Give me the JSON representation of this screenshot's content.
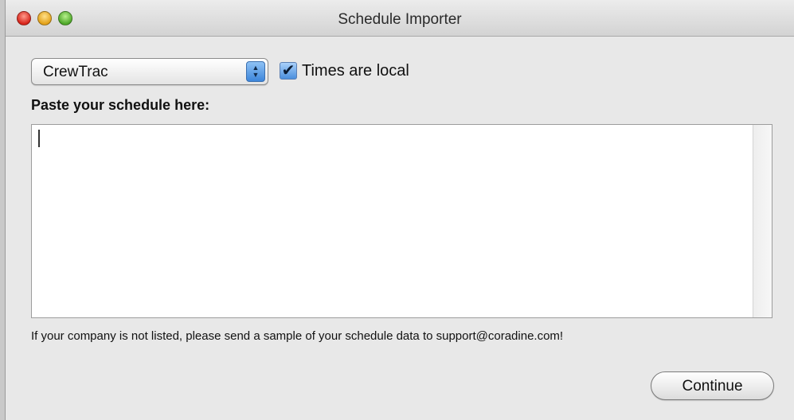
{
  "window": {
    "title": "Schedule Importer"
  },
  "import_source": {
    "selected": "CrewTrac"
  },
  "times_local": {
    "label": "Times are local",
    "checked": true
  },
  "schedule": {
    "label": "Paste your schedule here:",
    "value": ""
  },
  "note": "If your company is not listed, please send a sample of your schedule data to support@coradine.com!",
  "actions": {
    "continue_label": "Continue"
  },
  "icons": {
    "close": "close-icon",
    "minimize": "minimize-icon",
    "zoom": "zoom-icon",
    "popup_arrows": "updown-chevron-icon",
    "checkmark": "checkmark-icon"
  },
  "colors": {
    "accent": "#4b8fdd",
    "close": "#d8251b",
    "minimize": "#e3a21a",
    "zoom": "#4fa92a"
  }
}
